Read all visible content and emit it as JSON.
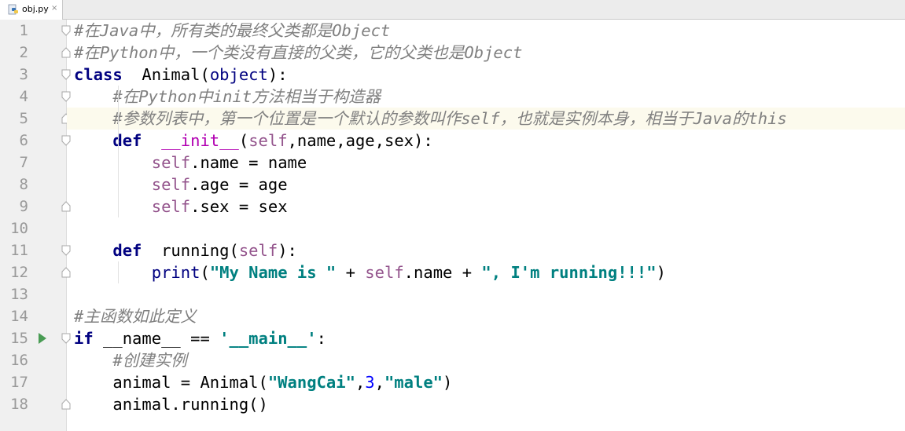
{
  "tab": {
    "file_name": "obj.py",
    "close": "×",
    "icon": "python-file-icon"
  },
  "colors": {
    "keyword": "#000080",
    "comment": "#808080",
    "string": "#008080",
    "self": "#94558d",
    "number": "#0000ff",
    "dunder": "#b200b2",
    "current_line": "#fcfaed",
    "run_arrow": "#499c54"
  },
  "editor": {
    "current_line": 5,
    "lines": [
      {
        "n": "1",
        "segs": [
          [
            "cm",
            "#在Java中，所有类的最终父类都是Object"
          ]
        ]
      },
      {
        "n": "2",
        "segs": [
          [
            "cm",
            "#在Python中，一个类没有直接的父类，它的父类也是Object"
          ]
        ]
      },
      {
        "n": "3",
        "segs": [
          [
            "kw",
            "class"
          ],
          [
            "",
            "  Animal("
          ],
          [
            "bi",
            "object"
          ],
          [
            "",
            "):"
          ]
        ]
      },
      {
        "n": "4",
        "segs": [
          [
            "",
            "    "
          ],
          [
            "cm",
            "#在Python中init方法相当于构造器"
          ]
        ]
      },
      {
        "n": "5",
        "segs": [
          [
            "",
            "    "
          ],
          [
            "cm",
            "#参数列表中，第一个位置是一个默认的参数叫作self，也就是实例本身，相当于Java的this"
          ]
        ]
      },
      {
        "n": "6",
        "segs": [
          [
            "",
            "    "
          ],
          [
            "kw",
            "def"
          ],
          [
            "",
            "  "
          ],
          [
            "dn",
            "__init__"
          ],
          [
            "",
            "("
          ],
          [
            "sf",
            "self"
          ],
          [
            "",
            ",name,age,sex):"
          ]
        ]
      },
      {
        "n": "7",
        "segs": [
          [
            "",
            "        "
          ],
          [
            "sf",
            "self"
          ],
          [
            "",
            ".name = name"
          ]
        ]
      },
      {
        "n": "8",
        "segs": [
          [
            "",
            "        "
          ],
          [
            "sf",
            "self"
          ],
          [
            "",
            ".age = age"
          ]
        ]
      },
      {
        "n": "9",
        "segs": [
          [
            "",
            "        "
          ],
          [
            "sf",
            "self"
          ],
          [
            "",
            ".sex = sex"
          ]
        ]
      },
      {
        "n": "10",
        "segs": []
      },
      {
        "n": "11",
        "segs": [
          [
            "",
            "    "
          ],
          [
            "kw",
            "def"
          ],
          [
            "",
            "  running("
          ],
          [
            "sf",
            "self"
          ],
          [
            "",
            "):"
          ]
        ]
      },
      {
        "n": "12",
        "segs": [
          [
            "",
            "        "
          ],
          [
            "bi",
            "print"
          ],
          [
            "",
            "("
          ],
          [
            "st",
            "\"My Name is \""
          ],
          [
            "",
            " + "
          ],
          [
            "sf",
            "self"
          ],
          [
            "",
            ".name + "
          ],
          [
            "st",
            "\", I'm running!!!\""
          ],
          [
            "",
            ")"
          ]
        ]
      },
      {
        "n": "13",
        "segs": []
      },
      {
        "n": "14",
        "segs": [
          [
            "cm",
            "#主函数如此定义"
          ]
        ]
      },
      {
        "n": "15",
        "segs": [
          [
            "kw",
            "if"
          ],
          [
            "",
            " __name__ == "
          ],
          [
            "st",
            "'__main__'"
          ],
          [
            "",
            ":"
          ]
        ]
      },
      {
        "n": "16",
        "segs": [
          [
            "",
            "    "
          ],
          [
            "cm",
            "#创建实例"
          ]
        ]
      },
      {
        "n": "17",
        "segs": [
          [
            "",
            "    animal = Animal("
          ],
          [
            "st",
            "\"WangCai\""
          ],
          [
            "",
            ","
          ],
          [
            "nm",
            "3"
          ],
          [
            "",
            ","
          ],
          [
            "st",
            "\"male\""
          ],
          [
            "",
            ")"
          ]
        ]
      },
      {
        "n": "18",
        "segs": [
          [
            "",
            "    animal.running()"
          ]
        ]
      }
    ]
  },
  "folds": {
    "open": [
      1,
      3,
      4,
      6,
      11,
      15
    ],
    "close": [
      2,
      5,
      9,
      12,
      18
    ]
  }
}
